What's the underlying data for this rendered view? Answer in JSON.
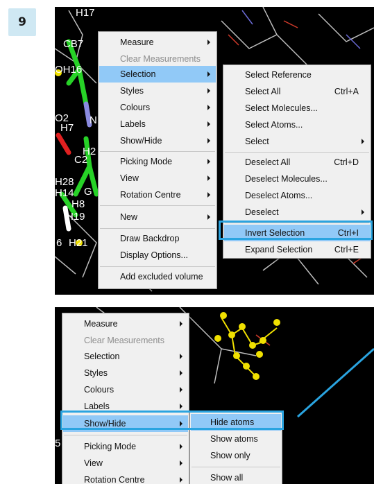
{
  "step": {
    "number": "9"
  },
  "top": {
    "atom_labels": [
      "H17",
      "CB7",
      "OH16",
      "O2",
      "H7",
      "N",
      "C2",
      "H2",
      "H28",
      "H14",
      "H8",
      "H19",
      "H21",
      "G",
      "6"
    ],
    "context_menu": {
      "items": [
        {
          "label": "Measure",
          "submenu": true
        },
        {
          "label": "Clear Measurements",
          "disabled": true
        },
        {
          "label": "Selection",
          "submenu": true,
          "highlighted": true
        },
        {
          "label": "Styles",
          "submenu": true
        },
        {
          "label": "Colours",
          "submenu": true
        },
        {
          "label": "Labels",
          "submenu": true
        },
        {
          "label": "Show/Hide",
          "submenu": true
        },
        {
          "label": "Picking Mode",
          "submenu": true
        },
        {
          "label": "View",
          "submenu": true
        },
        {
          "label": "Rotation Centre",
          "submenu": true
        },
        {
          "label": "New",
          "submenu": true
        },
        {
          "label": "Draw Backdrop"
        },
        {
          "label": "Display Options..."
        },
        {
          "label": "Add excluded volume"
        }
      ]
    },
    "selection_submenu": {
      "items": [
        {
          "label": "Select Reference",
          "shortcut": ""
        },
        {
          "label": "Select All",
          "shortcut": "Ctrl+A"
        },
        {
          "label": "Select Molecules...",
          "shortcut": ""
        },
        {
          "label": "Select Atoms...",
          "shortcut": ""
        },
        {
          "label": "Select",
          "shortcut": "",
          "submenu": true
        },
        {
          "label": "Deselect All",
          "shortcut": "Ctrl+D"
        },
        {
          "label": "Deselect Molecules...",
          "shortcut": ""
        },
        {
          "label": "Deselect Atoms...",
          "shortcut": ""
        },
        {
          "label": "Deselect",
          "shortcut": "",
          "submenu": true
        },
        {
          "label": "Invert Selection",
          "shortcut": "Ctrl+I",
          "highlighted": true
        },
        {
          "label": "Expand Selection",
          "shortcut": "Ctrl+E"
        }
      ]
    }
  },
  "bottom": {
    "atom_labels": [
      "5"
    ],
    "context_menu": {
      "items": [
        {
          "label": "Measure",
          "submenu": true
        },
        {
          "label": "Clear Measurements",
          "disabled": true
        },
        {
          "label": "Selection",
          "submenu": true
        },
        {
          "label": "Styles",
          "submenu": true
        },
        {
          "label": "Colours",
          "submenu": true
        },
        {
          "label": "Labels",
          "submenu": true
        },
        {
          "label": "Show/Hide",
          "submenu": true,
          "highlighted": true
        },
        {
          "label": "Picking Mode",
          "submenu": true
        },
        {
          "label": "View",
          "submenu": true
        },
        {
          "label": "Rotation Centre",
          "submenu": true
        }
      ]
    },
    "showhide_submenu": {
      "items": [
        {
          "label": "Hide atoms",
          "highlighted": true
        },
        {
          "label": "Show atoms"
        },
        {
          "label": "Show only"
        },
        {
          "label": "Show all"
        }
      ]
    }
  },
  "colors": {
    "highlight": "#91c9f7",
    "callout": "#2aa4e0",
    "badge": "#cfe8f3"
  }
}
